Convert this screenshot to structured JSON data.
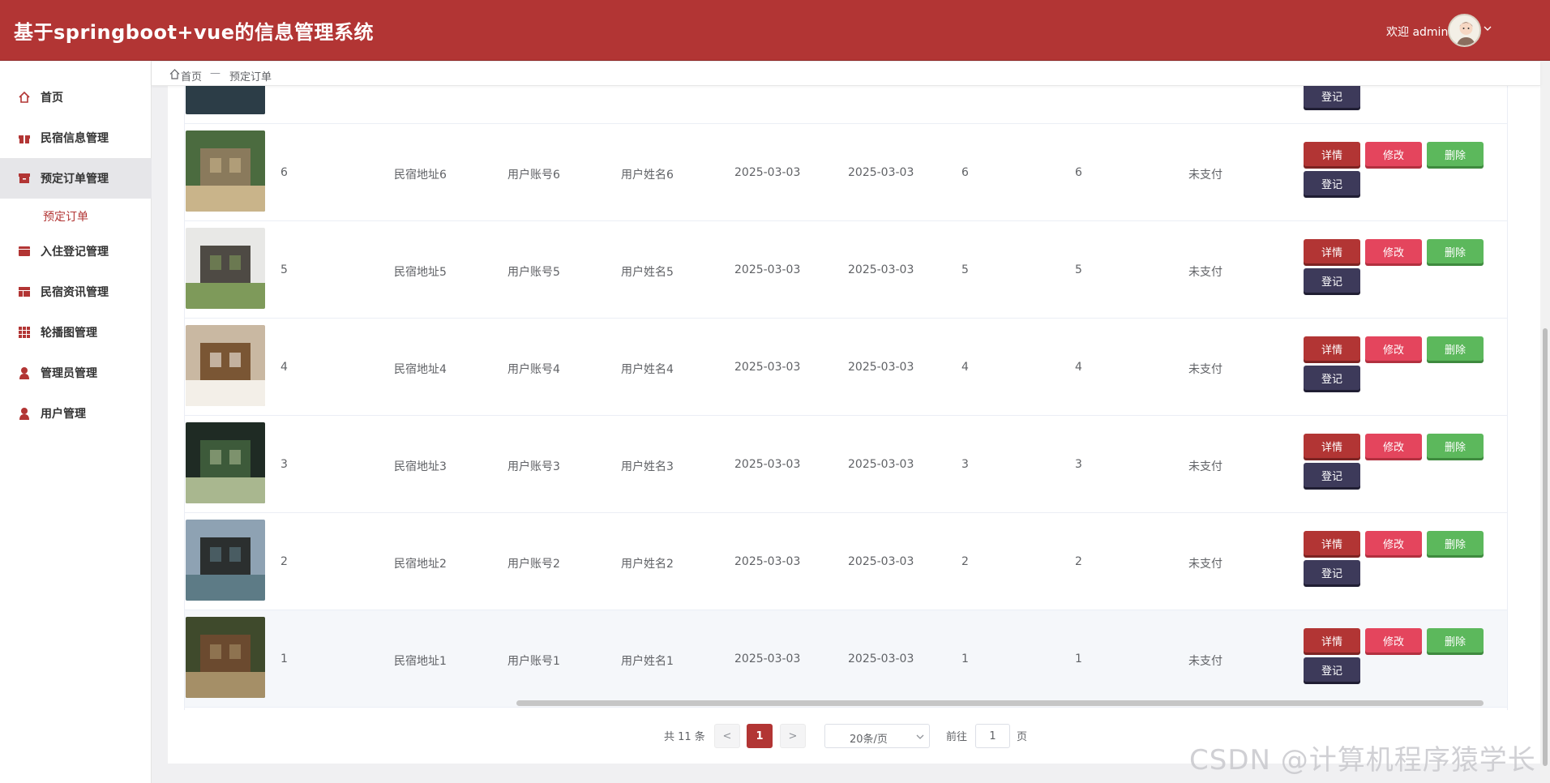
{
  "app": {
    "title": "基于springboot+vue的信息管理系统",
    "welcome": "欢迎 admin"
  },
  "colors": {
    "primary": "#b23534",
    "detail_button": "#b23534",
    "edit_button": "#e4455d",
    "delete_button": "#5cb85c",
    "register_button": "#3d3a5a"
  },
  "sidebar": {
    "items": [
      {
        "label": "首页",
        "icon": "home-icon"
      },
      {
        "label": "民宿信息管理",
        "icon": "gift-icon"
      },
      {
        "label": "预定订单管理",
        "icon": "archive-icon"
      },
      {
        "label": "入住登记管理",
        "icon": "folder-icon"
      },
      {
        "label": "民宿资讯管理",
        "icon": "table-icon"
      },
      {
        "label": "轮播图管理",
        "icon": "grid-icon"
      },
      {
        "label": "管理员管理",
        "icon": "user-icon"
      },
      {
        "label": "用户管理",
        "icon": "user-icon"
      }
    ],
    "sub_item": "预定订单"
  },
  "breadcrumb": {
    "home": "首页",
    "separator": "—",
    "current": "预定订单"
  },
  "table": {
    "partial_row_button": "登记",
    "rows": [
      {
        "id": "6",
        "address": "民宿地址6",
        "account": "用户账号6",
        "name": "用户姓名6",
        "date1": "2025-03-03",
        "date2": "2025-03-03",
        "col7": "6",
        "col8": "6",
        "status": "未支付"
      },
      {
        "id": "5",
        "address": "民宿地址5",
        "account": "用户账号5",
        "name": "用户姓名5",
        "date1": "2025-03-03",
        "date2": "2025-03-03",
        "col7": "5",
        "col8": "5",
        "status": "未支付"
      },
      {
        "id": "4",
        "address": "民宿地址4",
        "account": "用户账号4",
        "name": "用户姓名4",
        "date1": "2025-03-03",
        "date2": "2025-03-03",
        "col7": "4",
        "col8": "4",
        "status": "未支付"
      },
      {
        "id": "3",
        "address": "民宿地址3",
        "account": "用户账号3",
        "name": "用户姓名3",
        "date1": "2025-03-03",
        "date2": "2025-03-03",
        "col7": "3",
        "col8": "3",
        "status": "未支付"
      },
      {
        "id": "2",
        "address": "民宿地址2",
        "account": "用户账号2",
        "name": "用户姓名2",
        "date1": "2025-03-03",
        "date2": "2025-03-03",
        "col7": "2",
        "col8": "2",
        "status": "未支付"
      },
      {
        "id": "1",
        "address": "民宿地址1",
        "account": "用户账号1",
        "name": "用户姓名1",
        "date1": "2025-03-03",
        "date2": "2025-03-03",
        "col7": "1",
        "col8": "1",
        "status": "未支付"
      }
    ],
    "actions": {
      "detail": "详情",
      "edit": "修改",
      "delete": "删除",
      "register": "登记"
    }
  },
  "pagination": {
    "total": "共 11 条",
    "prev": "<",
    "current": "1",
    "next": ">",
    "page_size": "20条/页",
    "goto_label": "前往",
    "goto_value": "1",
    "page_suffix": "页"
  },
  "watermark": "CSDN @计算机程序猿学长"
}
